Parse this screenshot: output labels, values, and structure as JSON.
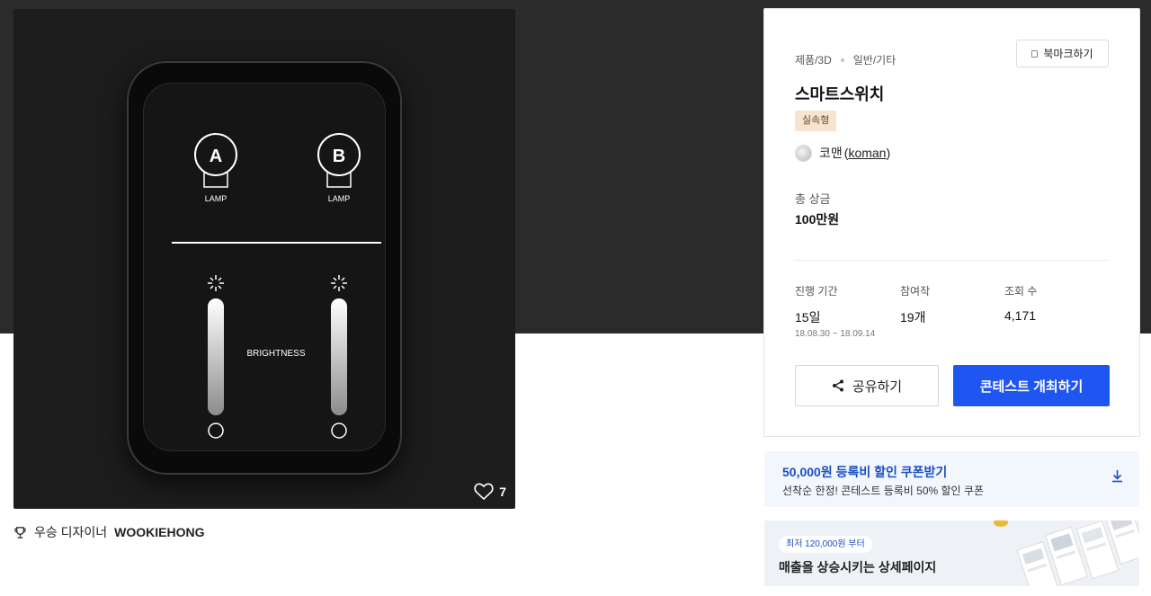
{
  "image": {
    "lamp_a_letter": "A",
    "lamp_b_letter": "B",
    "lamp_label": "LAMP",
    "brightness_label": "BRIGHTNESS",
    "like_count": "7"
  },
  "winner": {
    "prefix": "우승 디자이너",
    "name": "WOOKIEHONG"
  },
  "panel": {
    "breadcrumb": [
      "제품/3D",
      "일반/기타"
    ],
    "bookmark_label": "북마크하기",
    "title": "스마트스위치",
    "tag": "실속형",
    "host_name": "코맨",
    "host_id": "koman",
    "prize_label": "총 상금",
    "prize_value": "100만원",
    "stats": [
      {
        "label": "진행 기간",
        "value": "15일",
        "sub": "18.08.30 ~ 18.09.14"
      },
      {
        "label": "참여작",
        "value": "19개",
        "sub": ""
      },
      {
        "label": "조회 수",
        "value": "4,171",
        "sub": ""
      }
    ],
    "share_label": "공유하기",
    "host_contest_label": "콘테스트 개최하기"
  },
  "coupon": {
    "title": "50,000원 등록비 할인 쿠폰받기",
    "subtitle": "선착순 한정! 콘테스트 등록비 50% 할인 쿠폰"
  },
  "banner": {
    "pill": "최저 120,000원 부터",
    "title": "매출을 상승시키는 상세페이지"
  },
  "colors": {
    "accent": "#1f55f0",
    "coupon_text": "#1b4ec4",
    "tag_bg": "#f7e3cf"
  }
}
